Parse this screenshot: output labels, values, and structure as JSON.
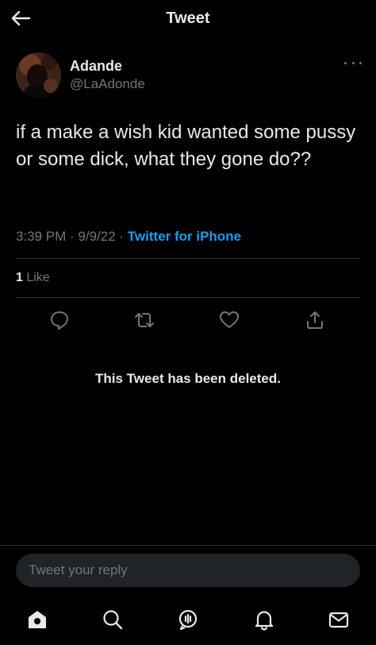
{
  "header": {
    "title": "Tweet",
    "back_icon": "arrow-left-icon"
  },
  "author": {
    "name": "Adande",
    "handle": "@LaAdonde",
    "more_icon": "more-horizontal-icon"
  },
  "tweet": {
    "text": "if a make a wish kid wanted some pussy or some dick, what they gone do??",
    "time": "3:39 PM",
    "separator": " · ",
    "date": "9/9/22",
    "source": "Twitter for iPhone"
  },
  "stats": {
    "like_count": "1",
    "like_label": " Like"
  },
  "actions": [
    {
      "name": "reply",
      "icon": "reply-icon"
    },
    {
      "name": "retweet",
      "icon": "retweet-icon"
    },
    {
      "name": "like",
      "icon": "heart-icon"
    },
    {
      "name": "share",
      "icon": "share-icon"
    }
  ],
  "deleted_notice": "This Tweet has been deleted.",
  "reply_box": {
    "placeholder": "Tweet your reply"
  },
  "bottom_nav": [
    {
      "name": "home",
      "icon": "home-icon"
    },
    {
      "name": "search",
      "icon": "search-icon"
    },
    {
      "name": "spaces",
      "icon": "spaces-icon"
    },
    {
      "name": "notifications",
      "icon": "bell-icon"
    },
    {
      "name": "messages",
      "icon": "mail-icon"
    }
  ],
  "colors": {
    "background": "#000000",
    "text": "#e7e9ea",
    "secondary_text": "#71767b",
    "accent": "#1d9bf0",
    "divider": "#2f3336",
    "input_background": "#202327"
  }
}
